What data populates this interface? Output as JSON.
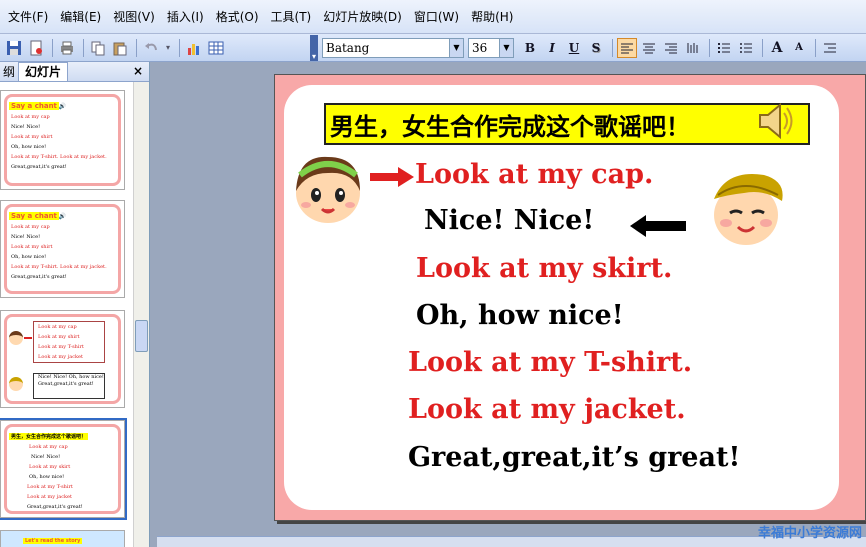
{
  "menu": {
    "items": [
      "文件(F)",
      "编辑(E)",
      "视图(V)",
      "插入(I)",
      "格式(O)",
      "工具(T)",
      "幻灯片放映(D)",
      "窗口(W)",
      "帮助(H)"
    ]
  },
  "toolbar": {
    "font_name": "Batang",
    "font_size": "36",
    "bold": "B",
    "italic": "I",
    "underline": "U",
    "shadow": "S",
    "increase_font": "A",
    "decrease_font": "A"
  },
  "pane": {
    "tab_outline": "纲",
    "tab_slides": "幻灯片",
    "close": "×",
    "thumbs": [
      {
        "title": "Say a chant",
        "lines": [
          {
            "text": "Look at my cap",
            "color": "red"
          },
          {
            "text": "Nice! Nice!",
            "color": "black"
          },
          {
            "text": "Look at my shirt",
            "color": "red"
          },
          {
            "text": "Oh, how nice!",
            "color": "black"
          },
          {
            "text": "Look at my T-shirt. Look at my jacket.",
            "color": "red"
          },
          {
            "text": "Great,great,it's great!",
            "color": "black"
          }
        ]
      },
      {
        "title": "Say a chant",
        "lines": [
          {
            "text": "Look at my cap",
            "color": "red"
          },
          {
            "text": "Nice! Nice!",
            "color": "black"
          },
          {
            "text": "Look at my shirt",
            "color": "red"
          },
          {
            "text": "Oh, how nice!",
            "color": "black"
          },
          {
            "text": "Look at my T-shirt. Look at my jacket.",
            "color": "red"
          },
          {
            "text": "Great,great,it's great!",
            "color": "black"
          }
        ]
      },
      {
        "title": "",
        "lines": [
          {
            "text": "Look at my cap",
            "color": "red"
          },
          {
            "text": "Look at my shirt",
            "color": "red"
          },
          {
            "text": "Look at my T-shirt",
            "color": "red"
          },
          {
            "text": "Look at my jacket",
            "color": "red"
          },
          {
            "text": "Nice! Nice! Oh, how nice! Great,great,it's great!",
            "color": "black"
          }
        ]
      },
      {
        "title": "男生，女生合作完成这个歌谣吧！",
        "lines": [
          {
            "text": "Look at my cap",
            "color": "red"
          },
          {
            "text": "Nice! Nice!",
            "color": "black"
          },
          {
            "text": "Look at my skirt",
            "color": "red"
          },
          {
            "text": "Oh, how nice!",
            "color": "black"
          },
          {
            "text": "Look at my T-shirt",
            "color": "red"
          },
          {
            "text": "Look at my jacket",
            "color": "red"
          },
          {
            "text": "Great,great,it's great!",
            "color": "black"
          }
        ]
      },
      {
        "title": "Let's read the story",
        "lines": []
      }
    ]
  },
  "slide": {
    "title": "男生，女生合作完成这个歌谣吧！",
    "lines": [
      {
        "text": "Look at my cap.",
        "color": "red"
      },
      {
        "text": "Nice! Nice!",
        "color": "black"
      },
      {
        "text": "Look at my skirt.",
        "color": "red"
      },
      {
        "text": "Oh, how nice!",
        "color": "black"
      },
      {
        "text": "Look at my T-shirt.",
        "color": "red"
      },
      {
        "text": "Look at my jacket.",
        "color": "red"
      },
      {
        "text": "Great,great,it’s great!",
        "color": "black"
      }
    ],
    "colors": {
      "red": "#e02020",
      "black": "#000000",
      "banner": "#ffff00",
      "frame": "#f8a8a8"
    }
  },
  "watermark": "幸福中小学资源网"
}
